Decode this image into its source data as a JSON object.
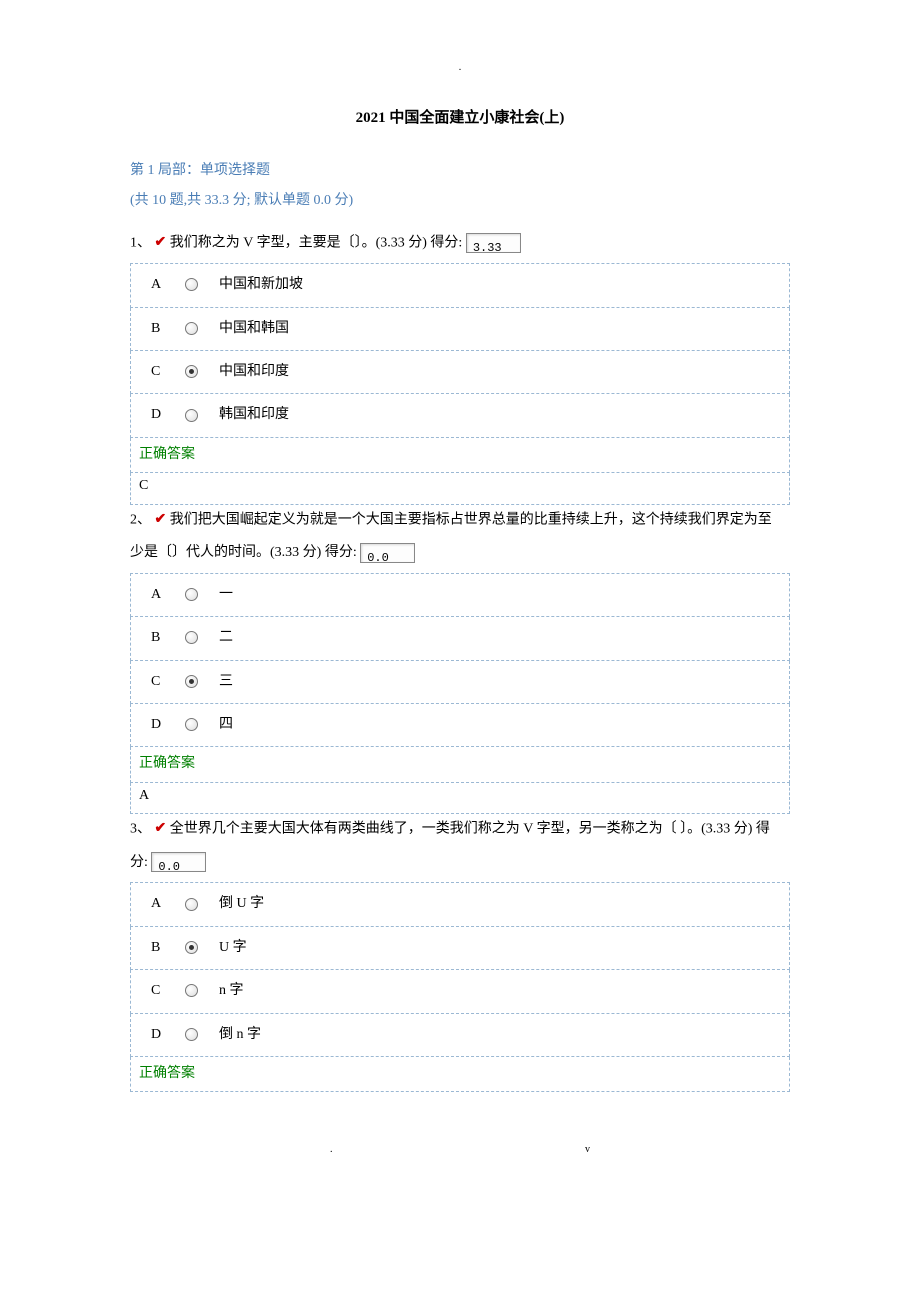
{
  "dot": ".",
  "page_title": "2021 中国全面建立小康社会(上)",
  "section": {
    "header": "第 1 局部：单项选择题",
    "sub": "(共 10 题,共 33.3 分; 默认单题 0.0 分)"
  },
  "labels": {
    "score_prefix": "得分:",
    "correct_answer": "正确答案"
  },
  "q1": {
    "num": "1、",
    "text_before": "我们称之为 V 字型，主要是〔〕。(3.33 分) ",
    "score": "3.33",
    "opts": {
      "A": "中国和新加坡",
      "B": "中国和韩国",
      "C": "中国和印度",
      "D": "韩国和印度"
    },
    "selected": "C",
    "answer": "C"
  },
  "q2": {
    "num": "2、",
    "text_line1": "我们把大国崛起定义为就是一个大国主要指标占世界总量的比重持续上升，这个持续我们界定为至",
    "text_line2": "少是〔〕代人的时间。(3.33 分) ",
    "score": "0.0",
    "opts": {
      "A": "一",
      "B": "二",
      "C": "三",
      "D": "四"
    },
    "selected": "C",
    "answer": "A"
  },
  "q3": {
    "num": "3、",
    "text_line1": "全世界几个主要大国大体有两类曲线了，一类我们称之为 V 字型，另一类称之为〔  〕。(3.33 分) 得",
    "text_line2": "分:",
    "score": "0.0",
    "opts": {
      "A": "倒 U 字",
      "B": "U 字",
      "C": "n 字",
      "D": "倒 n 字"
    },
    "selected": "B"
  },
  "footer": {
    "left": ".",
    "right": "v"
  }
}
